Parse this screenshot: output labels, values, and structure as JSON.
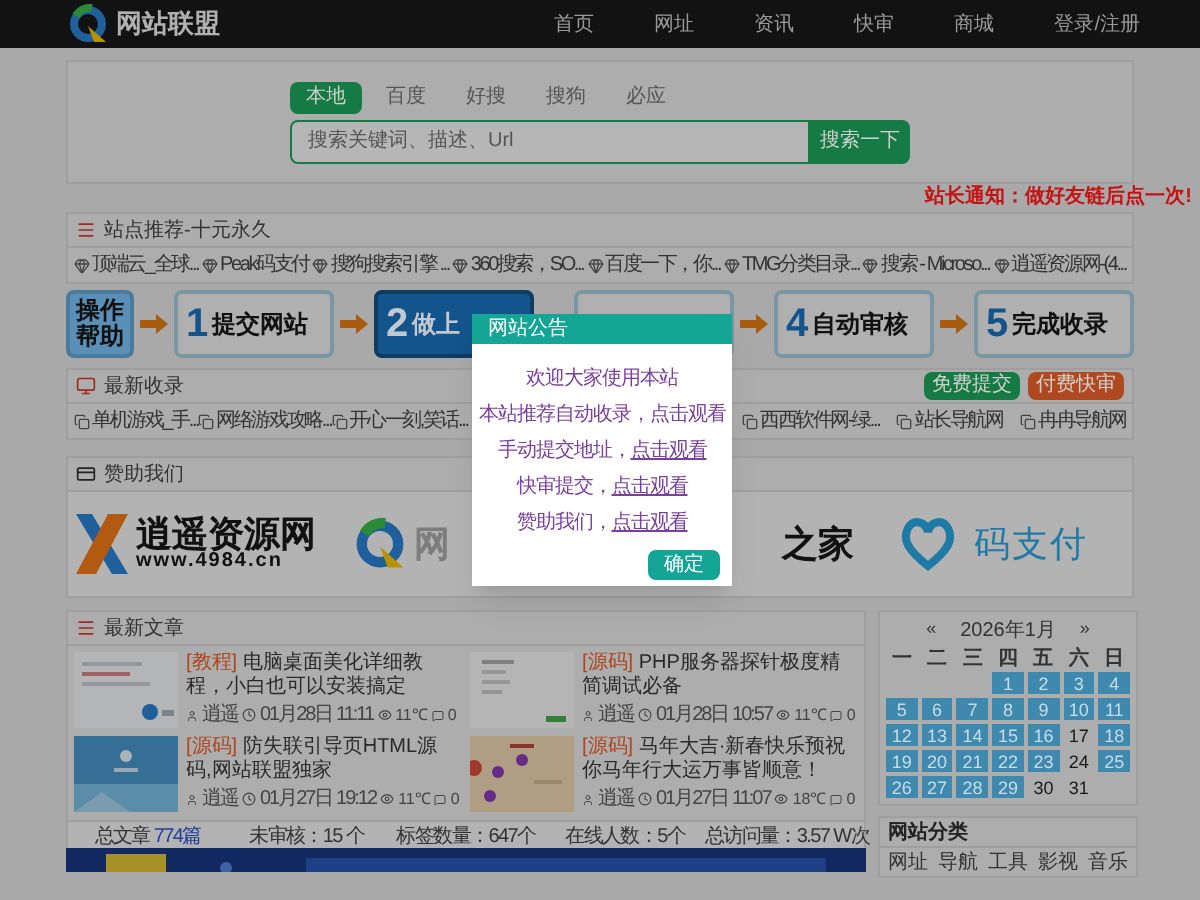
{
  "header": {
    "logo_text": "网站联盟",
    "nav": [
      "首页",
      "网址",
      "资讯",
      "快审",
      "商城",
      "登录/注册"
    ]
  },
  "search": {
    "tabs": [
      {
        "label": "本地",
        "selected": true
      },
      {
        "label": "百度",
        "selected": false
      },
      {
        "label": "好搜",
        "selected": false
      },
      {
        "label": "搜狗",
        "selected": false
      },
      {
        "label": "必应",
        "selected": false
      }
    ],
    "placeholder": "搜索关键词、描述、Url",
    "button": "搜索一下"
  },
  "notice": "站长通知：做好友链后点一次!",
  "recommend": {
    "title": "站点推荐-十元永久",
    "links": [
      "顶端云_全球...",
      "Peak码支付",
      "搜狗搜索引擎 ...",
      "360搜索，SO...",
      "百度一下，你...",
      "TMG分类目录...",
      "搜索 - Microso...",
      "逍遥资源网-(4..."
    ]
  },
  "steps": [
    {
      "kind": "help",
      "label": "操作帮助",
      "highlighted": false
    },
    {
      "kind": "step",
      "number": "1",
      "label": "提交网站",
      "highlighted": false
    },
    {
      "kind": "step",
      "number": "2",
      "label": "做上",
      "highlighted": true
    },
    {
      "kind": "covered",
      "highlighted": false
    },
    {
      "kind": "step",
      "number": "4",
      "label": "自动审核",
      "highlighted": false
    },
    {
      "kind": "step",
      "number": "5",
      "label": "完成收录",
      "highlighted": false
    }
  ],
  "latest": {
    "title": "最新收录",
    "buttons": [
      {
        "label": "免费提交",
        "color": "#157a43"
      },
      {
        "label": "付费快审",
        "color": "#b0491f"
      }
    ],
    "links": [
      "单机游戏_手...",
      "网络游戏攻略...",
      "开心一刻,笑话...",
      "西西软件网-绿...",
      "站长导航网",
      "冉冉导航网"
    ]
  },
  "sponsors": {
    "title": "赞助我们",
    "items": [
      {
        "kind": "xiaoyao",
        "name": "逍遥资源网",
        "url": "www.4984.cn"
      },
      {
        "kind": "lianmeng",
        "name": "网"
      },
      {
        "kind": "home",
        "name": "之家"
      },
      {
        "kind": "mazhifu",
        "name": "码支付"
      }
    ]
  },
  "articles": {
    "title": "最新文章",
    "items": [
      {
        "tag": "[教程]",
        "title": "电脑桌面美化详细教程，小白也可以安装搞定",
        "author": "逍遥",
        "time": "01月28日 11:11",
        "views": "11℃",
        "comments": "0"
      },
      {
        "tag": "[源码]",
        "title": "PHP服务器探针极度精简调试必备",
        "author": "逍遥",
        "time": "01月28日 10:57",
        "views": "11℃",
        "comments": "0"
      },
      {
        "tag": "[源码]",
        "title": "防失联引导页HTML源码,网站联盟独家",
        "author": "逍遥",
        "time": "01月27日 19:12",
        "views": "11℃",
        "comments": "0"
      },
      {
        "tag": "[源码]",
        "title": "马年大吉·新春快乐预祝你马年行大运万事皆顺意！",
        "author": "逍遥",
        "time": "01月27日 11:07",
        "views": "18℃",
        "comments": "0"
      }
    ]
  },
  "stats": [
    {
      "label": "总文章",
      "value": "774篇"
    },
    {
      "label": "未审核：15 个"
    },
    {
      "label": "标签数量：647个"
    },
    {
      "label": "在线人数：5个"
    },
    {
      "label": "总访问量：3.57 W次"
    }
  ],
  "calendar": {
    "prev": "«",
    "title": "2026年1月",
    "next": "»",
    "weekdays": [
      "一",
      "二",
      "三",
      "四",
      "五",
      "六",
      "日"
    ],
    "weeks": [
      [
        {
          "day": "1",
          "marked": true
        },
        {
          "day": "2",
          "marked": true
        },
        {
          "day": "3",
          "marked": true
        },
        {
          "day": "4",
          "marked": true
        }
      ],
      [
        {
          "day": "5",
          "marked": true
        },
        {
          "day": "6",
          "marked": true
        },
        {
          "day": "7",
          "marked": true
        },
        {
          "day": "8",
          "marked": true
        },
        {
          "day": "9",
          "marked": true
        },
        {
          "day": "10",
          "marked": true
        },
        {
          "day": "11",
          "marked": true
        }
      ],
      [
        {
          "day": "12",
          "marked": true
        },
        {
          "day": "13",
          "marked": true
        },
        {
          "day": "14",
          "marked": true
        },
        {
          "day": "15",
          "marked": true
        },
        {
          "day": "16",
          "marked": true
        },
        {
          "day": "17",
          "marked": false
        },
        {
          "day": "18",
          "marked": true
        }
      ],
      [
        {
          "day": "19",
          "marked": true
        },
        {
          "day": "20",
          "marked": true
        },
        {
          "day": "21",
          "marked": true
        },
        {
          "day": "22",
          "marked": true
        },
        {
          "day": "23",
          "marked": true
        },
        {
          "day": "24",
          "marked": false
        },
        {
          "day": "25",
          "marked": true
        }
      ],
      [
        {
          "day": "26",
          "marked": true
        },
        {
          "day": "27",
          "marked": true
        },
        {
          "day": "28",
          "marked": true
        },
        {
          "day": "29",
          "marked": true
        },
        {
          "day": "30",
          "marked": false
        },
        {
          "day": "31",
          "marked": false
        }
      ]
    ]
  },
  "categories": {
    "title": "网站分类",
    "items": [
      "网址",
      "导航",
      "工具",
      "影视",
      "音乐"
    ]
  },
  "modal": {
    "title": "网站公告",
    "lines": [
      {
        "text": "欢迎大家使用本站"
      },
      {
        "text": "本站推荐自动收录，点击观看"
      },
      {
        "text": "手动提交地址，",
        "link": "点击观看"
      },
      {
        "text": "快审提交，",
        "link": "点击观看"
      },
      {
        "text": "赞助我们，",
        "link": "点击观看"
      }
    ],
    "button": "确定"
  }
}
